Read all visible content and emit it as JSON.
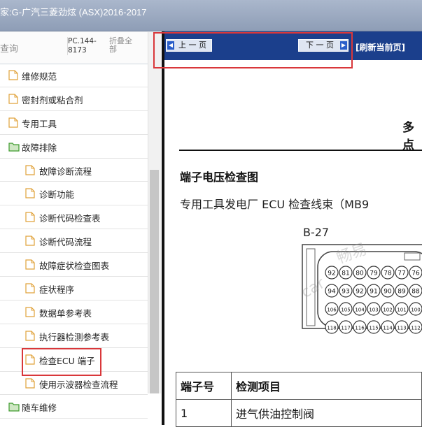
{
  "window": {
    "title": "家:G-广汽三菱劲炫 (ASX)2016-2017"
  },
  "left_panel": {
    "search_label": "查询",
    "pc_code": "PC.144-8173",
    "collapse_all": "折叠全部"
  },
  "tree": {
    "items": [
      {
        "label": "维修规范",
        "level": 1,
        "type": "doc"
      },
      {
        "label": "密封剂或粘合剂",
        "level": 1,
        "type": "doc"
      },
      {
        "label": "专用工具",
        "level": 1,
        "type": "doc"
      },
      {
        "label": "故障排除",
        "level": 1,
        "type": "folder-open"
      },
      {
        "label": "故障诊断流程",
        "level": 2,
        "type": "doc"
      },
      {
        "label": "诊断功能",
        "level": 2,
        "type": "doc"
      },
      {
        "label": "诊断代码检查表",
        "level": 2,
        "type": "doc"
      },
      {
        "label": "诊断代码流程",
        "level": 2,
        "type": "doc"
      },
      {
        "label": "故障症状检查图表",
        "level": 2,
        "type": "doc"
      },
      {
        "label": "症状程序",
        "level": 2,
        "type": "doc"
      },
      {
        "label": "数据单参考表",
        "level": 2,
        "type": "doc"
      },
      {
        "label": "执行器检测参考表",
        "level": 2,
        "type": "doc"
      },
      {
        "label": "检查ECU 端子",
        "level": 2,
        "type": "doc",
        "highlighted": true
      },
      {
        "label": "使用示波器检查流程",
        "level": 2,
        "type": "doc"
      },
      {
        "label": "随车维修",
        "level": 1,
        "type": "folder-open"
      }
    ]
  },
  "nav": {
    "prev_label": "上 一 页",
    "next_label": "下 一 页",
    "refresh_label": "[刷新当前页]"
  },
  "document": {
    "title_partial": "多点",
    "section_heading": "端子电压检查图",
    "subtitle": "专用工具发电厂 ECU 检查线束（MB9",
    "connector_label": "B-27",
    "pin_rows": [
      [
        "92",
        "81",
        "80",
        "79",
        "78",
        "77",
        "76"
      ],
      [
        "94",
        "93",
        "92",
        "91",
        "90",
        "89",
        "88"
      ],
      [
        "106",
        "105",
        "104",
        "103",
        "102",
        "101",
        "100"
      ],
      [
        "118",
        "117",
        "116",
        "115",
        "114",
        "113",
        "112"
      ]
    ],
    "table": {
      "headers": [
        "端子号",
        "检测项目"
      ],
      "rows": [
        [
          "1",
          "进气供油控制阀"
        ]
      ]
    }
  },
  "colors": {
    "nav_bg": "#1b3f8c",
    "highlight_red": "#d9373a",
    "titlebar": "#9aa8bf"
  },
  "watermarks": [
    "畅易",
    "car"
  ]
}
